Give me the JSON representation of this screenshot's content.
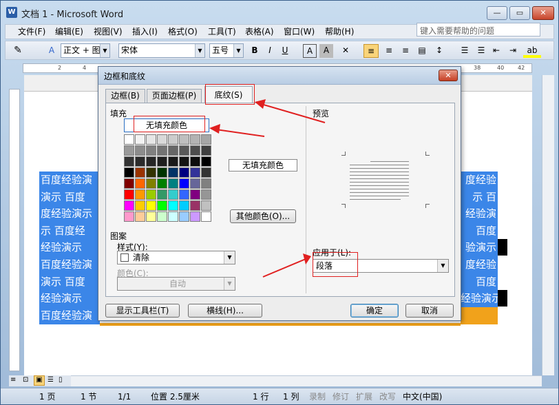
{
  "window": {
    "title": "文档 1 - Microsoft Word",
    "icon": "word-doc-icon",
    "minimize_glyph": "—",
    "maximize_glyph": "▭",
    "close_glyph": "✕"
  },
  "menubar": {
    "items": [
      "文件(F)",
      "编辑(E)",
      "视图(V)",
      "插入(I)",
      "格式(O)",
      "工具(T)",
      "表格(A)",
      "窗口(W)",
      "帮助(H)"
    ],
    "help_placeholder": "键入需要帮助的问题"
  },
  "toolbar": {
    "style_value": "正文 + 图案",
    "font_value": "宋体",
    "size_value": "五号",
    "bold": "B",
    "italic": "I",
    "underline": "U",
    "charborder": "A",
    "charshade": "A"
  },
  "ruler": {
    "labels": [
      "2",
      "4",
      "38",
      "40",
      "42"
    ]
  },
  "document": {
    "highlight_lines": [
      "百度经验演",
      "演示 百度",
      "度经验演示",
      "示 百度经",
      "经验演示",
      "百度经验演",
      "演示 百度",
      "经验演示",
      "百度经验演"
    ],
    "right_lines": [
      "度经验",
      "示 百",
      "经验演",
      "百度",
      "验演示",
      "度经验",
      "百度",
      "经验演示",
      ""
    ]
  },
  "dialog": {
    "title": "边框和底纹",
    "close_glyph": "✕",
    "tabs": [
      "边框(B)",
      "页面边框(P)",
      "底纹(S)"
    ],
    "active_tab": 2,
    "fill_label": "填充",
    "no_fill_button": "无填充颜色",
    "no_fill_preview": "无填充颜色",
    "more_colors_button": "其他颜色(O)...",
    "pattern_label": "图案",
    "style_label": "样式(Y):",
    "style_value": "清除",
    "color_label": "颜色(C):",
    "color_value": "自动",
    "preview_label": "预览",
    "apply_label": "应用于(L):",
    "apply_value": "段落",
    "show_toolbar_button": "显示工具栏(T)",
    "hline_button": "横线(H)...",
    "ok_button": "确定",
    "cancel_button": "取消",
    "palette": [
      [
        "#ffffff",
        "#f2f2f2",
        "#e6e6e6",
        "#d9d9d9",
        "#cccccc",
        "#bfbfbf",
        "#b3b3b3",
        "#a6a6a6"
      ],
      [
        "#999999",
        "#8c8c8c",
        "#808080",
        "#737373",
        "#666666",
        "#595959",
        "#4d4d4d",
        "#404040"
      ],
      [
        "#333333",
        "#2b2b2b",
        "#262626",
        "#1f1f1f",
        "#1a1a1a",
        "#141414",
        "#0d0d0d",
        "#000000"
      ],
      [
        "#000000",
        "#993300",
        "#333300",
        "#003300",
        "#003366",
        "#000080",
        "#333399",
        "#333333"
      ],
      [
        "#800000",
        "#ff6600",
        "#808000",
        "#008000",
        "#008080",
        "#0000ff",
        "#666699",
        "#808080"
      ],
      [
        "#ff0000",
        "#ff9900",
        "#99cc00",
        "#339966",
        "#33cccc",
        "#3366ff",
        "#800080",
        "#969696"
      ],
      [
        "#ff00ff",
        "#ffcc00",
        "#ffff00",
        "#00ff00",
        "#00ffff",
        "#00ccff",
        "#993366",
        "#c0c0c0"
      ],
      [
        "#ff99cc",
        "#ffcc99",
        "#ffff99",
        "#ccffcc",
        "#ccffff",
        "#99ccff",
        "#cc99ff",
        "#ffffff"
      ]
    ]
  },
  "statusbar": {
    "page": "1 页",
    "section": "1 节",
    "pages": "1/1",
    "position": "位置 2.5厘米",
    "line": "1 行",
    "column": "1 列",
    "rec": "录制",
    "trk": "修订",
    "ext": "扩展",
    "ovr": "改写",
    "lang": "中文(中国)"
  },
  "colors": {
    "highlight": "#3b86e8",
    "annotation": "#e02020",
    "shading_orange": "#f1a21b"
  }
}
